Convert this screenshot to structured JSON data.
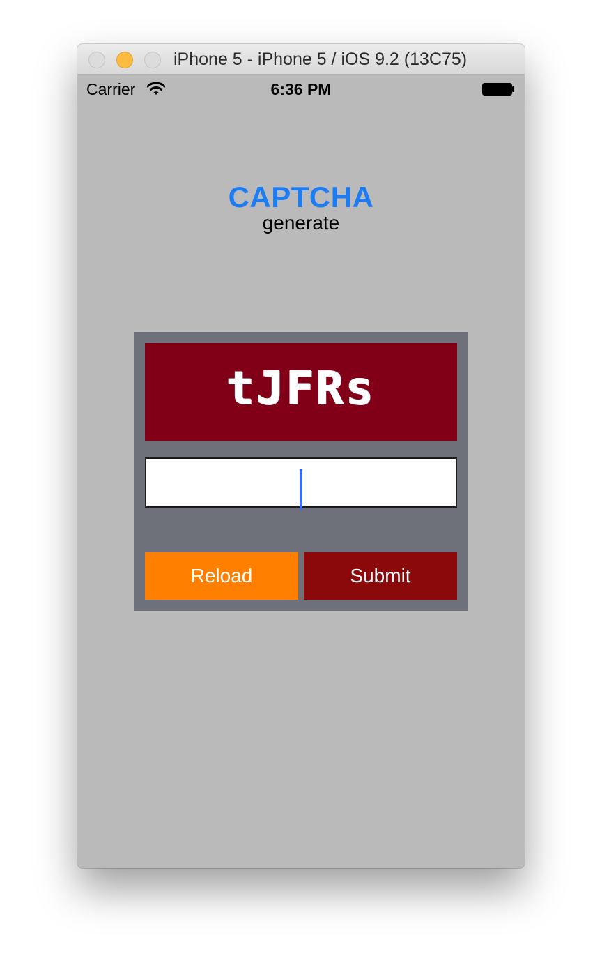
{
  "window": {
    "title": "iPhone 5 - iPhone 5 / iOS 9.2 (13C75)"
  },
  "status_bar": {
    "carrier": "Carrier",
    "time": "6:36 PM",
    "icons": [
      "wifi-icon",
      "battery-icon"
    ]
  },
  "header": {
    "title": "CAPTCHA",
    "subtitle": "generate"
  },
  "captcha": {
    "code": "tJFRs",
    "input_value": "",
    "reload_label": "Reload",
    "submit_label": "Submit"
  },
  "colors": {
    "title_blue": "#1d7cf2",
    "panel": "#6e717a",
    "captcha_bg": "#820017",
    "reload": "#ff8000",
    "submit": "#8b090b",
    "screen_bg": "#bababa"
  }
}
